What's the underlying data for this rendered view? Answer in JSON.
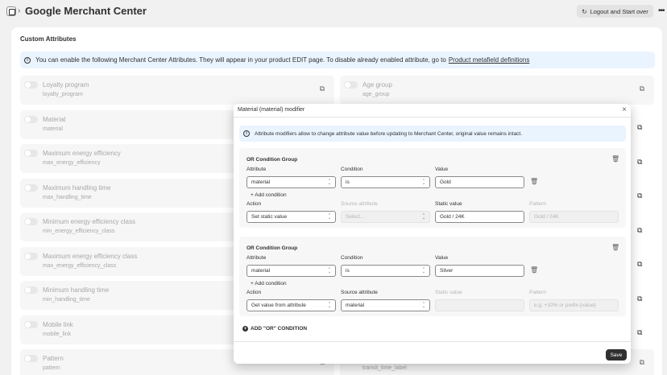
{
  "header": {
    "title": "Google Merchant Center",
    "separator": "›",
    "logout_label": "Logout and Start over",
    "logout_icon": "↻",
    "more_icon": "•••"
  },
  "section": {
    "title": "Custom Attributes",
    "banner_text": "You can enable the following Merchant Center Attributes. They will appear in your product EDIT page. To disable already enabled attribute, go to",
    "banner_link": "Product metafield definitions",
    "info_glyph": "i"
  },
  "attributes_left": [
    {
      "name": "Loyalty program",
      "key": "loyalty_program"
    },
    {
      "name": "Material",
      "key": "material"
    },
    {
      "name": "Maximum energy efficiency",
      "key": "max_energy_efficiency"
    },
    {
      "name": "Maximum handling time",
      "key": "max_handling_time"
    },
    {
      "name": "Minimum energy efficiency class",
      "key": "min_energy_efficiency_class"
    },
    {
      "name": "Maximum energy efficiency class",
      "key": "max_energy_efficiency_class"
    },
    {
      "name": "Minimum handling time",
      "key": "min_handling_time"
    },
    {
      "name": "Mobile link",
      "key": "mobile_link"
    },
    {
      "name": "Pattern",
      "key": "pattern"
    }
  ],
  "attributes_right": [
    {
      "name": "Age group",
      "key": "age_group"
    },
    {
      "name": "",
      "key": "transit_time_label"
    }
  ],
  "modifier_icon": "⧉",
  "modal": {
    "title": "Material (material) modifier",
    "close_glyph": "×",
    "banner_text": "Attribute modifiers allow to change attribute value before updating to Merchant Center, original value remains intact.",
    "labels": {
      "group": "OR Condition Group",
      "attribute": "Attribute",
      "condition": "Condition",
      "value": "Value",
      "add_condition": "+ Add condition",
      "action": "Action",
      "source_attribute": "Source attribute",
      "static_value": "Static value",
      "pattern": "Pattern"
    },
    "groups": [
      {
        "attribute": "material",
        "condition": "is",
        "value": "Gold",
        "action": "Set static value",
        "source_placeholder": "Select...",
        "static_value": "Gold / 24K",
        "pattern_placeholder": "Gold / 24K"
      },
      {
        "attribute": "material",
        "condition": "is",
        "value": "Silver",
        "action": "Get value from attribute",
        "source_value": "material",
        "static_value": "",
        "pattern_placeholder": "e.g. +10% or prefix-{value}"
      }
    ],
    "add_or_label": "ADD \"OR\" CONDITION",
    "add_or_glyph": "+",
    "trash_icon": "🗑",
    "save_label": "Save"
  }
}
